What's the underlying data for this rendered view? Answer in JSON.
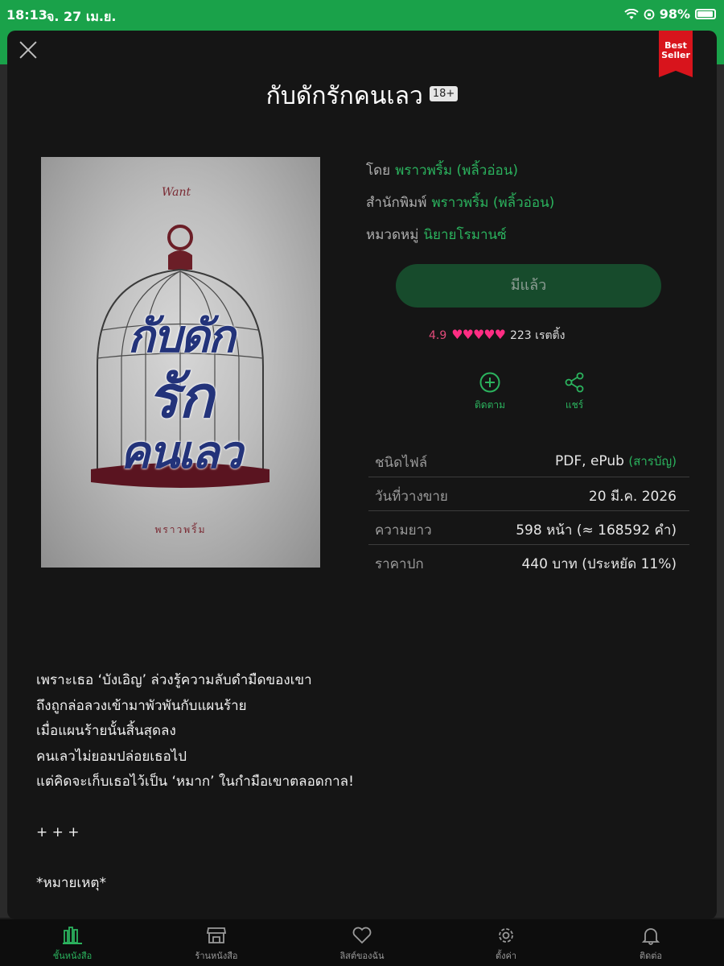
{
  "status_bar": {
    "time": "18:13",
    "date": "จ. 27 เม.ย.",
    "battery": "98%",
    "accent": "#1aa24a"
  },
  "sheet": {
    "ribbon": {
      "line1": "Best",
      "line2": "Seller",
      "color": "#d8141c"
    },
    "title": "กับดักรักคนเลว",
    "age_badge": "18+"
  },
  "cover": {
    "publisher_mark": "Want",
    "title_lines": [
      "กับดัก",
      "รัก",
      "คนเลว"
    ],
    "author": "พราวพริ้ม"
  },
  "info": {
    "author_label": "โดย",
    "author_value": "พราวพริ้ม (พลิ้วอ่อน)",
    "publisher_label": "สำนักพิมพ์",
    "publisher_value": "พราวพริ้ม (พลิ้วอ่อน)",
    "category_label": "หมวดหมู่",
    "category_value": "นิยายโรมานซ์",
    "owned_button": "มีแล้ว",
    "rating_score": "4.9",
    "rating_hearts": 5,
    "rating_count": "223 เรตติ้ง",
    "follow_label": "ติดตาม",
    "share_label": "แชร์"
  },
  "details": {
    "file_type_label": "ชนิดไฟล์",
    "file_type_value": "PDF, ePub",
    "toc_link": "(สารบัญ)",
    "release_label": "วันที่วางขาย",
    "release_value": "20 มี.ค. 2026",
    "length_label": "ความยาว",
    "length_value": "598  หน้า (≈ 168592 คำ)",
    "price_label": "ราคาปก",
    "price_value": "440 บาท (ประหยัด 11%)"
  },
  "synopsis": [
    "เพราะเธอ ‘บังเอิญ’ ล่วงรู้ความลับดำมืดของเขา",
    "ถึงถูกล่อลวงเข้ามาพัวพันกับแผนร้าย",
    "เมื่อแผนร้ายนั้นสิ้นสุดลง",
    "คนเลวไม่ยอมปล่อยเธอไป",
    "แต่คิดจะเก็บเธอไว้เป็น ‘หมาก’ ในกำมือเขาตลอดกาล!",
    "",
    "+ + +",
    "",
    "*หมายเหตุ*"
  ],
  "tabbar": {
    "items": [
      {
        "label": "ชั้นหนังสือ",
        "icon": "bookshelf-icon",
        "active": true
      },
      {
        "label": "ร้านหนังสือ",
        "icon": "store-icon",
        "active": false
      },
      {
        "label": "ลิสต์ของฉัน",
        "icon": "heart-icon",
        "active": false
      },
      {
        "label": "ตั้งค่า",
        "icon": "gear-icon",
        "active": false
      },
      {
        "label": "ติดต่อ",
        "icon": "bell-icon",
        "active": false
      }
    ]
  }
}
